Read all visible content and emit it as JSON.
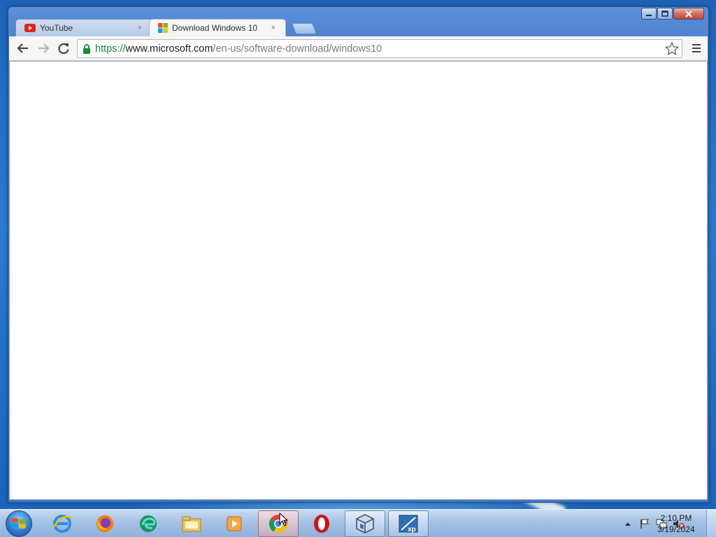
{
  "window": {
    "controls": {
      "minimize_icon": "minimize-icon",
      "maximize_icon": "maximize-icon",
      "close_icon": "close-icon"
    }
  },
  "tabs": [
    {
      "title": "YouTube",
      "icon": "youtube-favicon",
      "active": false,
      "close": "×"
    },
    {
      "title": "Download Windows 10",
      "icon": "windows-favicon",
      "active": true,
      "close": "×"
    }
  ],
  "toolbar": {
    "url_scheme": "https://",
    "url_host": "www.microsoft.com",
    "url_path": "/en-us/software-download/windows10"
  },
  "taskbar": {
    "pinned": [
      {
        "name": "internet-explorer-icon"
      },
      {
        "name": "firefox-icon"
      },
      {
        "name": "edge-icon"
      },
      {
        "name": "file-explorer-icon"
      },
      {
        "name": "media-player-icon"
      },
      {
        "name": "chrome-icon",
        "active": true
      },
      {
        "name": "opera-icon"
      },
      {
        "name": "virtualbox-icon",
        "open": true
      },
      {
        "name": "virtual-xp-icon",
        "open": true
      }
    ],
    "clock": {
      "time": "2:10 PM",
      "date": "3/19/2024"
    }
  },
  "colors": {
    "url_scheme": "#138a36",
    "url_host": "#202020",
    "url_path": "#7a7a7a"
  }
}
